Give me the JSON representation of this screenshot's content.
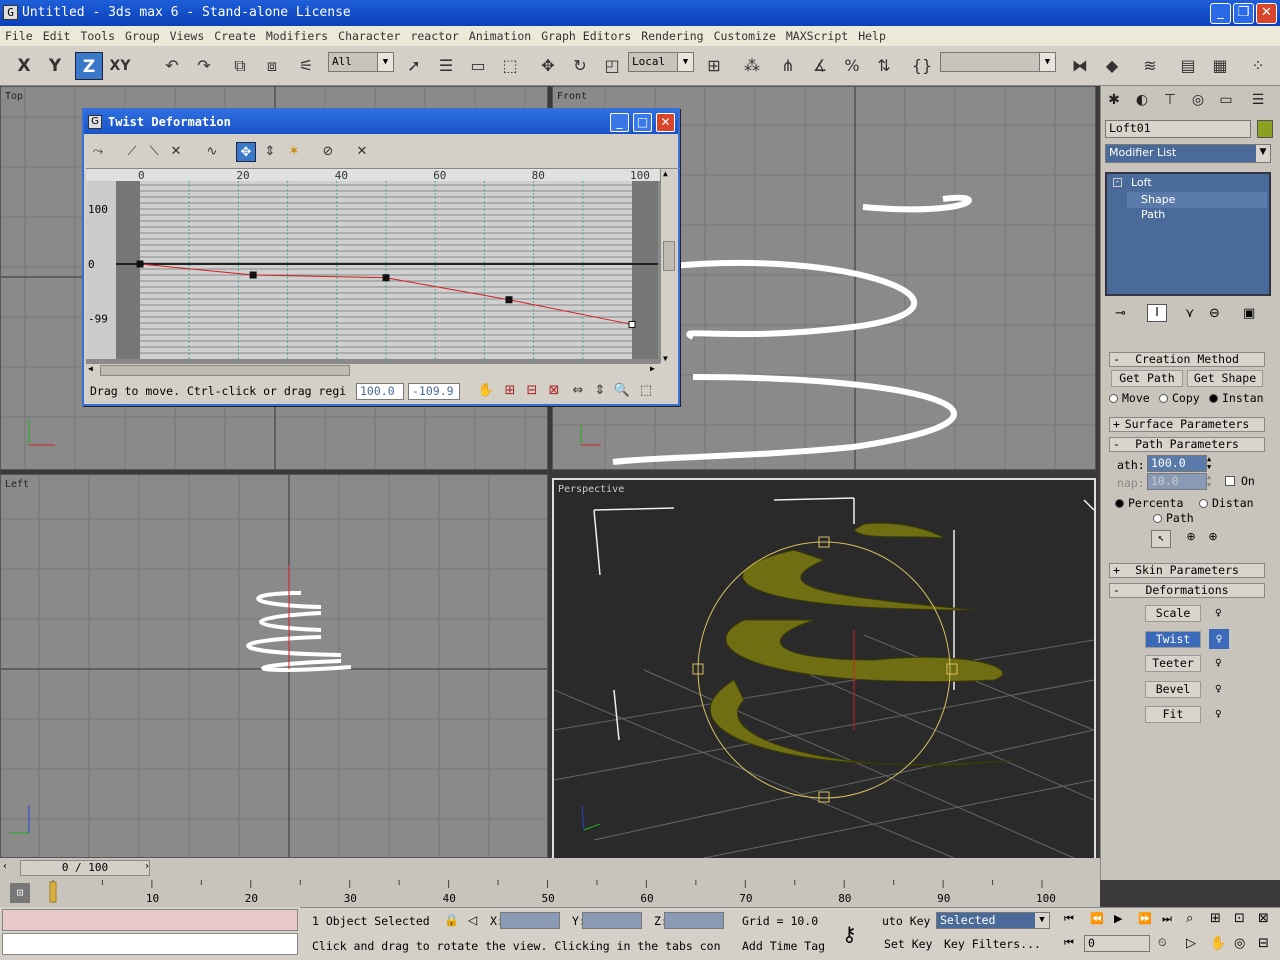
{
  "window": {
    "title": "Untitled  - 3ds max 6 - Stand-alone License",
    "icon": "G"
  },
  "menu": [
    "File",
    "Edit",
    "Tools",
    "Group",
    "Views",
    "Create",
    "Modifiers",
    "Character",
    "reactor",
    "Animation",
    "Graph Editors",
    "Rendering",
    "Customize",
    "MAXScript",
    "Help"
  ],
  "toolbar": {
    "axis_x": "X",
    "axis_y": "Y",
    "axis_z": "Z",
    "axis_xy": "XY",
    "selection_filter": "All",
    "ref_coord": "Local"
  },
  "viewports": {
    "top": "Top",
    "front": "Front",
    "left": "Left",
    "perspective": "Perspective"
  },
  "cmd": {
    "object_name": "Loft01",
    "modifier_list": "Modifier List",
    "stack": [
      "Loft",
      "Shape",
      "Path"
    ],
    "creation_method": "Creation Method",
    "get_path": "Get Path",
    "get_shape": "Get Shape",
    "move": "Move",
    "copy": "Copy",
    "instance": "Instan",
    "surface_params": "Surface Parameters",
    "path_params": "Path Parameters",
    "path_label": "ath:",
    "path_value": "100.0",
    "snap_label": "nap:",
    "snap_value": "10.0",
    "on": "On",
    "percentage": "Percenta",
    "distance": "Distan",
    "path_steps": "Path",
    "skin_params": "Skin Parameters",
    "deformations": "Deformations",
    "scale": "Scale",
    "twist": "Twist",
    "teeter": "Teeter",
    "bevel": "Bevel",
    "fit": "Fit"
  },
  "dialog": {
    "title": "Twist Deformation",
    "ruler": [
      "0",
      "20",
      "40",
      "60",
      "80",
      "100"
    ],
    "y_labels": [
      "100",
      "0",
      "-99"
    ],
    "status": "Drag to move. Ctrl-click or drag regi",
    "x_value": "100.0",
    "y_value": "-109.9"
  },
  "chart_data": {
    "type": "line",
    "title": "Twist Deformation",
    "x": [
      0,
      23,
      50,
      75,
      100
    ],
    "values": [
      0,
      -20,
      -25,
      -65,
      -109.9
    ],
    "xlim": [
      0,
      100
    ],
    "ylim": [
      -99,
      100
    ]
  },
  "timeline": {
    "frame": "0 / 100",
    "ticks": [
      "10",
      "20",
      "30",
      "40",
      "50",
      "60",
      "70",
      "80",
      "90",
      "100"
    ]
  },
  "status": {
    "selected": "1 Object Selected",
    "x": "X:",
    "y": "Y:",
    "z": "Z:",
    "grid": "Grid = 10.0",
    "prompt": "Click and drag to rotate the view.  Clicking in the tabs con",
    "add_time_tag": "Add Time Tag",
    "auto_key": "uto Key",
    "selected_dd": "Selected",
    "set_key": "Set Key",
    "key_filters": "Key Filters...",
    "frame_field": "0"
  }
}
